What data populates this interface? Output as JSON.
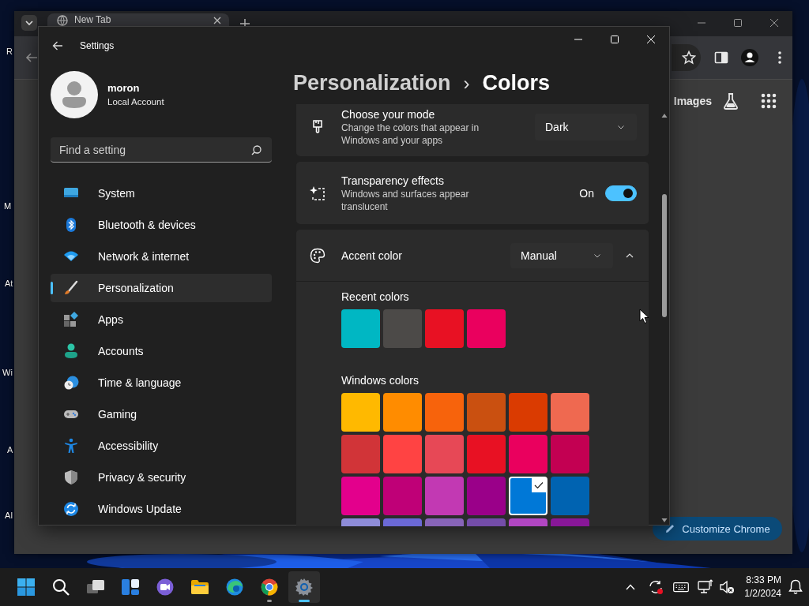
{
  "desktop": {
    "icon_labels": [
      "R",
      "M",
      "At",
      "Wi",
      "A",
      "AI"
    ]
  },
  "browser": {
    "tab": {
      "title": "New Tab"
    },
    "images_link": "Images",
    "customize_button": "Customize Chrome"
  },
  "settings": {
    "title": "Settings",
    "account": {
      "name": "moron",
      "type": "Local Account"
    },
    "search": {
      "placeholder": "Find a setting"
    },
    "nav": [
      {
        "label": "System",
        "selected": false
      },
      {
        "label": "Bluetooth & devices",
        "selected": false
      },
      {
        "label": "Network & internet",
        "selected": false
      },
      {
        "label": "Personalization",
        "selected": true
      },
      {
        "label": "Apps",
        "selected": false
      },
      {
        "label": "Accounts",
        "selected": false
      },
      {
        "label": "Time & language",
        "selected": false
      },
      {
        "label": "Gaming",
        "selected": false
      },
      {
        "label": "Accessibility",
        "selected": false
      },
      {
        "label": "Privacy & security",
        "selected": false
      },
      {
        "label": "Windows Update",
        "selected": false
      }
    ],
    "breadcrumb": {
      "parent": "Personalization",
      "separator": "›",
      "current": "Colors"
    },
    "cards": [
      {
        "kind": "dropdown",
        "title": "Choose your mode",
        "description": "Change the colors that appear in Windows and your apps",
        "value": "Dark"
      },
      {
        "kind": "toggle",
        "title": "Transparency effects",
        "description": "Windows and surfaces appear translucent",
        "state_label": "On",
        "on": true
      },
      {
        "kind": "expander",
        "title": "Accent color",
        "value": "Manual",
        "expanded": true,
        "sections": [
          {
            "title": "Recent colors",
            "swatches": [
              {
                "color": "#00b7c3",
                "selected": false
              },
              {
                "color": "#4c4a48",
                "selected": false
              },
              {
                "color": "#e81123",
                "selected": false
              },
              {
                "color": "#ea005e",
                "selected": false
              }
            ]
          },
          {
            "title": "Windows colors",
            "swatches": [
              {
                "color": "#ffb900",
                "selected": false
              },
              {
                "color": "#ff8c00",
                "selected": false
              },
              {
                "color": "#f7630c",
                "selected": false
              },
              {
                "color": "#ca5010",
                "selected": false
              },
              {
                "color": "#da3b01",
                "selected": false
              },
              {
                "color": "#ef6950",
                "selected": false
              },
              {
                "color": "#d13438",
                "selected": false
              },
              {
                "color": "#ff4343",
                "selected": false
              },
              {
                "color": "#e74856",
                "selected": false
              },
              {
                "color": "#e81123",
                "selected": false
              },
              {
                "color": "#ea005e",
                "selected": false
              },
              {
                "color": "#c30052",
                "selected": false
              },
              {
                "color": "#e3008c",
                "selected": false
              },
              {
                "color": "#bf0077",
                "selected": false
              },
              {
                "color": "#c239b3",
                "selected": false
              },
              {
                "color": "#9a0089",
                "selected": false
              },
              {
                "color": "#0078d7",
                "selected": true
              },
              {
                "color": "#0063b1",
                "selected": false
              },
              {
                "color": "#8e8cd8",
                "selected": false
              },
              {
                "color": "#6b69d6",
                "selected": false
              },
              {
                "color": "#8764b8",
                "selected": false
              },
              {
                "color": "#744da9",
                "selected": false
              },
              {
                "color": "#b146c2",
                "selected": false
              },
              {
                "color": "#881798",
                "selected": false
              }
            ]
          }
        ]
      }
    ]
  },
  "taskbar": {
    "apps": [
      {
        "running": false,
        "selected": false
      },
      {
        "running": false,
        "selected": false
      },
      {
        "running": false,
        "selected": false
      },
      {
        "running": false,
        "selected": false
      },
      {
        "running": false,
        "selected": false
      },
      {
        "running": false,
        "selected": false
      },
      {
        "running": false,
        "selected": false
      },
      {
        "running": true,
        "selected": false
      },
      {
        "running": true,
        "selected": true
      }
    ],
    "clock": {
      "time": "8:33 PM",
      "date": "1/2/2024"
    }
  }
}
